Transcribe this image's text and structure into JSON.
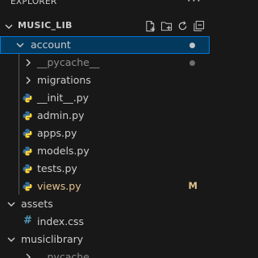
{
  "explorer": {
    "title": "EXPLORER",
    "more_label": "···"
  },
  "workspace": {
    "name": "MUSIC_LIB",
    "actions": [
      "new-file-icon",
      "new-folder-icon",
      "refresh-icon",
      "collapse-all-icon"
    ]
  },
  "tree": [
    {
      "label": "account",
      "type": "folder",
      "expanded": true,
      "selected": true,
      "badge": "dot",
      "badge_color": "#c5c5c5"
    },
    {
      "label": "__pycache__",
      "type": "folder",
      "expanded": false,
      "status": "ignored",
      "badge": "dot",
      "badge_color": "#6e6e6e"
    },
    {
      "label": "migrations",
      "type": "folder",
      "expanded": false
    },
    {
      "label": "__init__.py",
      "type": "python"
    },
    {
      "label": "admin.py",
      "type": "python"
    },
    {
      "label": "apps.py",
      "type": "python"
    },
    {
      "label": "models.py",
      "type": "python"
    },
    {
      "label": "tests.py",
      "type": "python"
    },
    {
      "label": "views.py",
      "type": "python",
      "status": "modified",
      "badge": "M"
    },
    {
      "label": "assets",
      "type": "folder",
      "expanded": true
    },
    {
      "label": "index.css",
      "type": "css",
      "icon_glyph": "#"
    },
    {
      "label": "musiclibrary",
      "type": "folder",
      "expanded": true
    },
    {
      "label": "__pycache__",
      "type": "folder",
      "expanded": false,
      "status": "ignored"
    }
  ],
  "colors": {
    "background": "#181818",
    "selection_bg": "#04395e",
    "selection_border": "#0078d4",
    "modified": "#e2c08d",
    "python_blue": "#3572a5",
    "python_yellow": "#ffd43b",
    "css": "#519aba"
  }
}
